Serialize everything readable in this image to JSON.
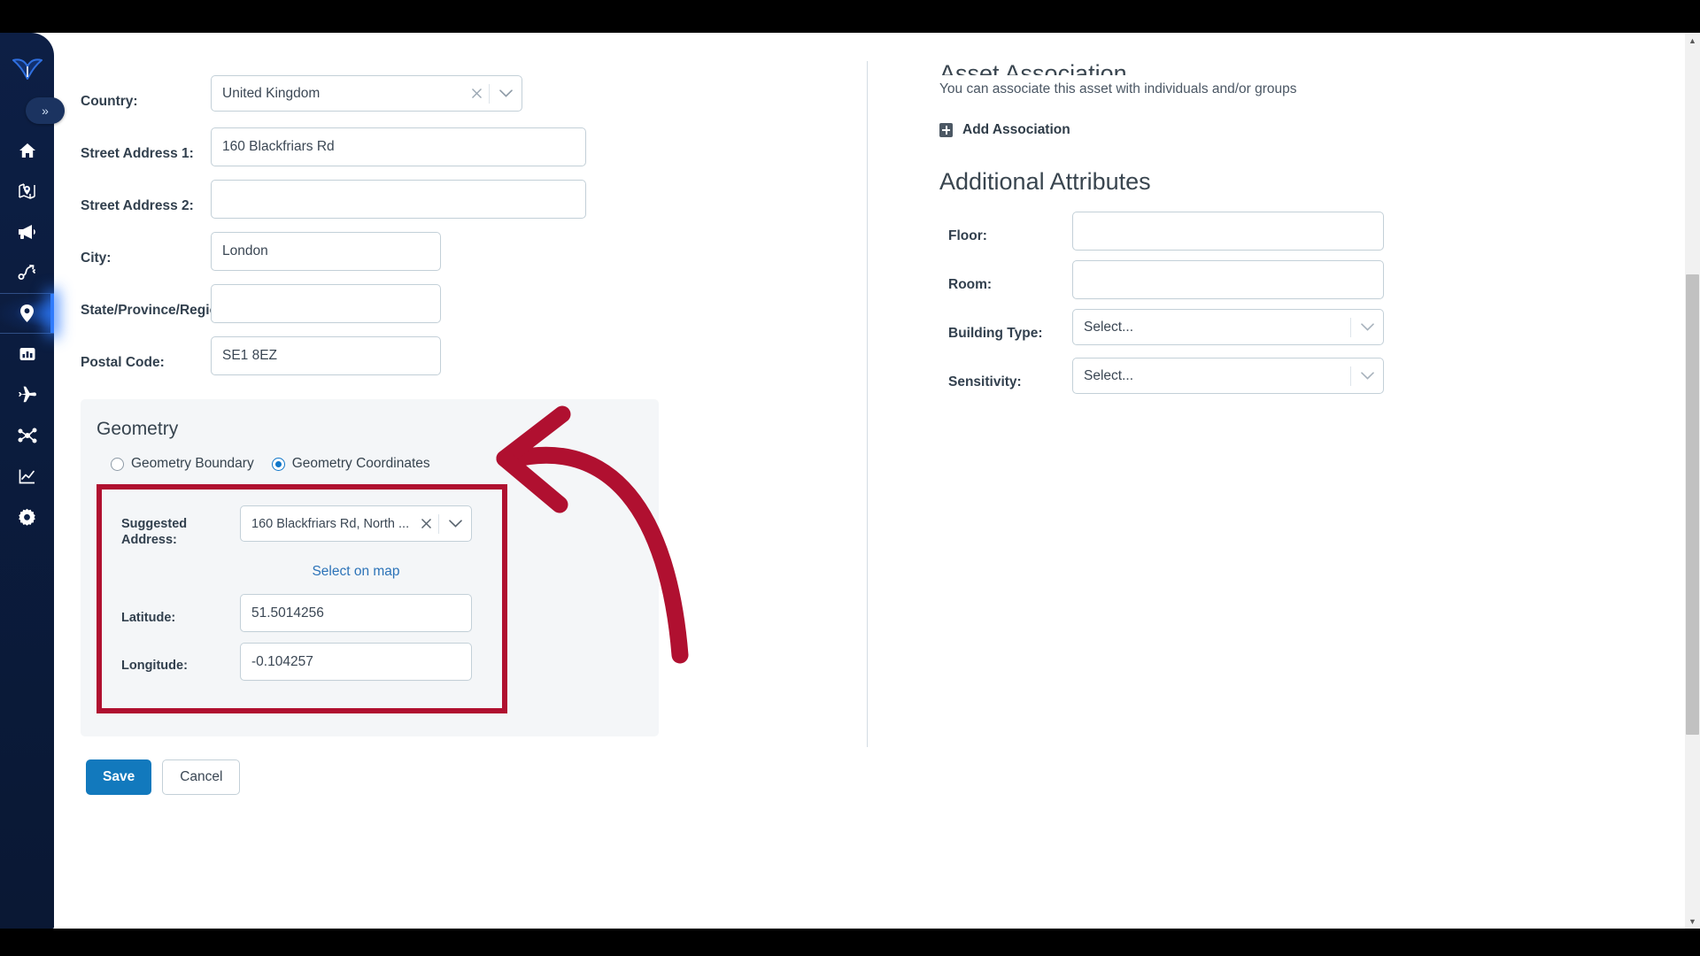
{
  "sidebar": {
    "logo_name": "app-logo",
    "collapse_label": "»",
    "items": [
      {
        "icon": "home-icon",
        "label": "Home",
        "active": false
      },
      {
        "icon": "map-pin-fold-icon",
        "label": "Map",
        "active": false
      },
      {
        "icon": "megaphone-icon",
        "label": "Announcements",
        "active": false
      },
      {
        "icon": "route-icon",
        "label": "Routes",
        "active": false
      },
      {
        "icon": "location-marker-icon",
        "label": "Assets",
        "active": true
      },
      {
        "icon": "building-chart-icon",
        "label": "Reports",
        "active": false
      },
      {
        "icon": "airplane-icon",
        "label": "Travel",
        "active": false
      },
      {
        "icon": "network-nodes-icon",
        "label": "Network",
        "active": false
      },
      {
        "icon": "line-chart-icon",
        "label": "Analytics",
        "active": false
      },
      {
        "icon": "gear-icon",
        "label": "Settings",
        "active": false
      }
    ]
  },
  "address_form": {
    "fields": [
      {
        "label": "Country:",
        "type": "select",
        "value": "United Kingdom",
        "width": "w352"
      },
      {
        "label": "Street Address 1:",
        "type": "input",
        "value": "160 Blackfriars Rd",
        "width": "w424"
      },
      {
        "label": "Street Address 2:",
        "type": "input",
        "value": "",
        "width": "w424"
      },
      {
        "label": "City:",
        "type": "input",
        "value": "London",
        "width": "w260"
      },
      {
        "label": "State/Province/Region:",
        "type": "input",
        "value": "",
        "width": "w260"
      },
      {
        "label": "Postal Code:",
        "type": "input",
        "value": "SE1 8EZ",
        "width": "w260"
      }
    ]
  },
  "geometry": {
    "title": "Geometry",
    "radio_boundary": "Geometry Boundary",
    "radio_coordinates": "Geometry Coordinates",
    "selected": "Geometry Coordinates",
    "suggested_address_label": "Suggested Address:",
    "suggested_address_value": "160 Blackfriars Rd, North ...",
    "select_on_map": "Select on map",
    "latitude_label": "Latitude:",
    "latitude_value": "51.5014256",
    "longitude_label": "Longitude:",
    "longitude_value": "-0.104257",
    "highlight_color": "#b01030"
  },
  "actions": {
    "save": "Save",
    "cancel": "Cancel",
    "save_color": "#1279bd"
  },
  "asset_association": {
    "title": "Asset Association",
    "subtitle": "You can associate this asset with individuals and/or groups",
    "add_label": "Add Association"
  },
  "additional_attributes": {
    "title": "Additional Attributes",
    "fields": [
      {
        "label": "Floor:",
        "type": "input",
        "value": "",
        "placeholder": ""
      },
      {
        "label": "Room:",
        "type": "input",
        "value": "",
        "placeholder": ""
      },
      {
        "label": "Building Type:",
        "type": "select",
        "value": "",
        "placeholder": "Select..."
      },
      {
        "label": "Sensitivity:",
        "type": "select",
        "value": "",
        "placeholder": "Select..."
      }
    ]
  },
  "scrollbar": {
    "up_arrow": "▲",
    "down_arrow": "▼"
  }
}
